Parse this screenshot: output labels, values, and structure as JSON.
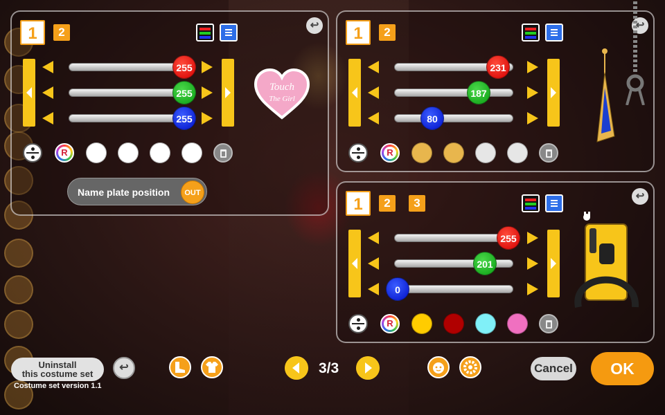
{
  "panels": {
    "left": {
      "tabs": [
        "1",
        "2"
      ],
      "sliders": [
        {
          "value": "255",
          "color": "#e0211a"
        },
        {
          "value": "255",
          "color": "#12a81a"
        },
        {
          "value": "255",
          "color": "#0a20d8"
        }
      ],
      "swatches": [
        "#ffffff",
        "#ffffff",
        "#ffffff",
        "#ffffff"
      ],
      "mode_icon": "mode-icon",
      "random_label": "R",
      "nameplate": {
        "label": "Name plate position",
        "toggle": "OUT"
      },
      "heart_text_line1": "Touch",
      "heart_text_line2": "The Girl"
    },
    "top_right": {
      "tabs": [
        "1",
        "2"
      ],
      "sliders": [
        {
          "value": "231",
          "fraction": 0.906
        },
        {
          "value": "187",
          "fraction": 0.733
        },
        {
          "value": "80",
          "fraction": 0.314
        }
      ],
      "swatches": [
        "#e8b64d",
        "#e8b64d",
        "#e6e6e6",
        "#e6e6e6"
      ],
      "random_label": "R"
    },
    "bottom_right": {
      "tabs": [
        "1",
        "2",
        "3"
      ],
      "sliders": [
        {
          "value": "255",
          "fraction": 1.0
        },
        {
          "value": "201",
          "fraction": 0.788
        },
        {
          "value": "0",
          "fraction": 0.0
        }
      ],
      "swatches": [
        "#ffcc00",
        "#b00000",
        "#80f0f8",
        "#f070c0"
      ],
      "random_label": "R"
    }
  },
  "bottom_bar": {
    "uninstall_line1": "Uninstall",
    "uninstall_line2": "this costume set",
    "version": "Costume set version 1.1",
    "reset_glyph": "↩",
    "page_indicator": "3/3",
    "cancel": "Cancel",
    "ok": "OK"
  },
  "colors": {
    "accent": "#f5a01a",
    "arrow_yellow": "#f7c51a"
  }
}
